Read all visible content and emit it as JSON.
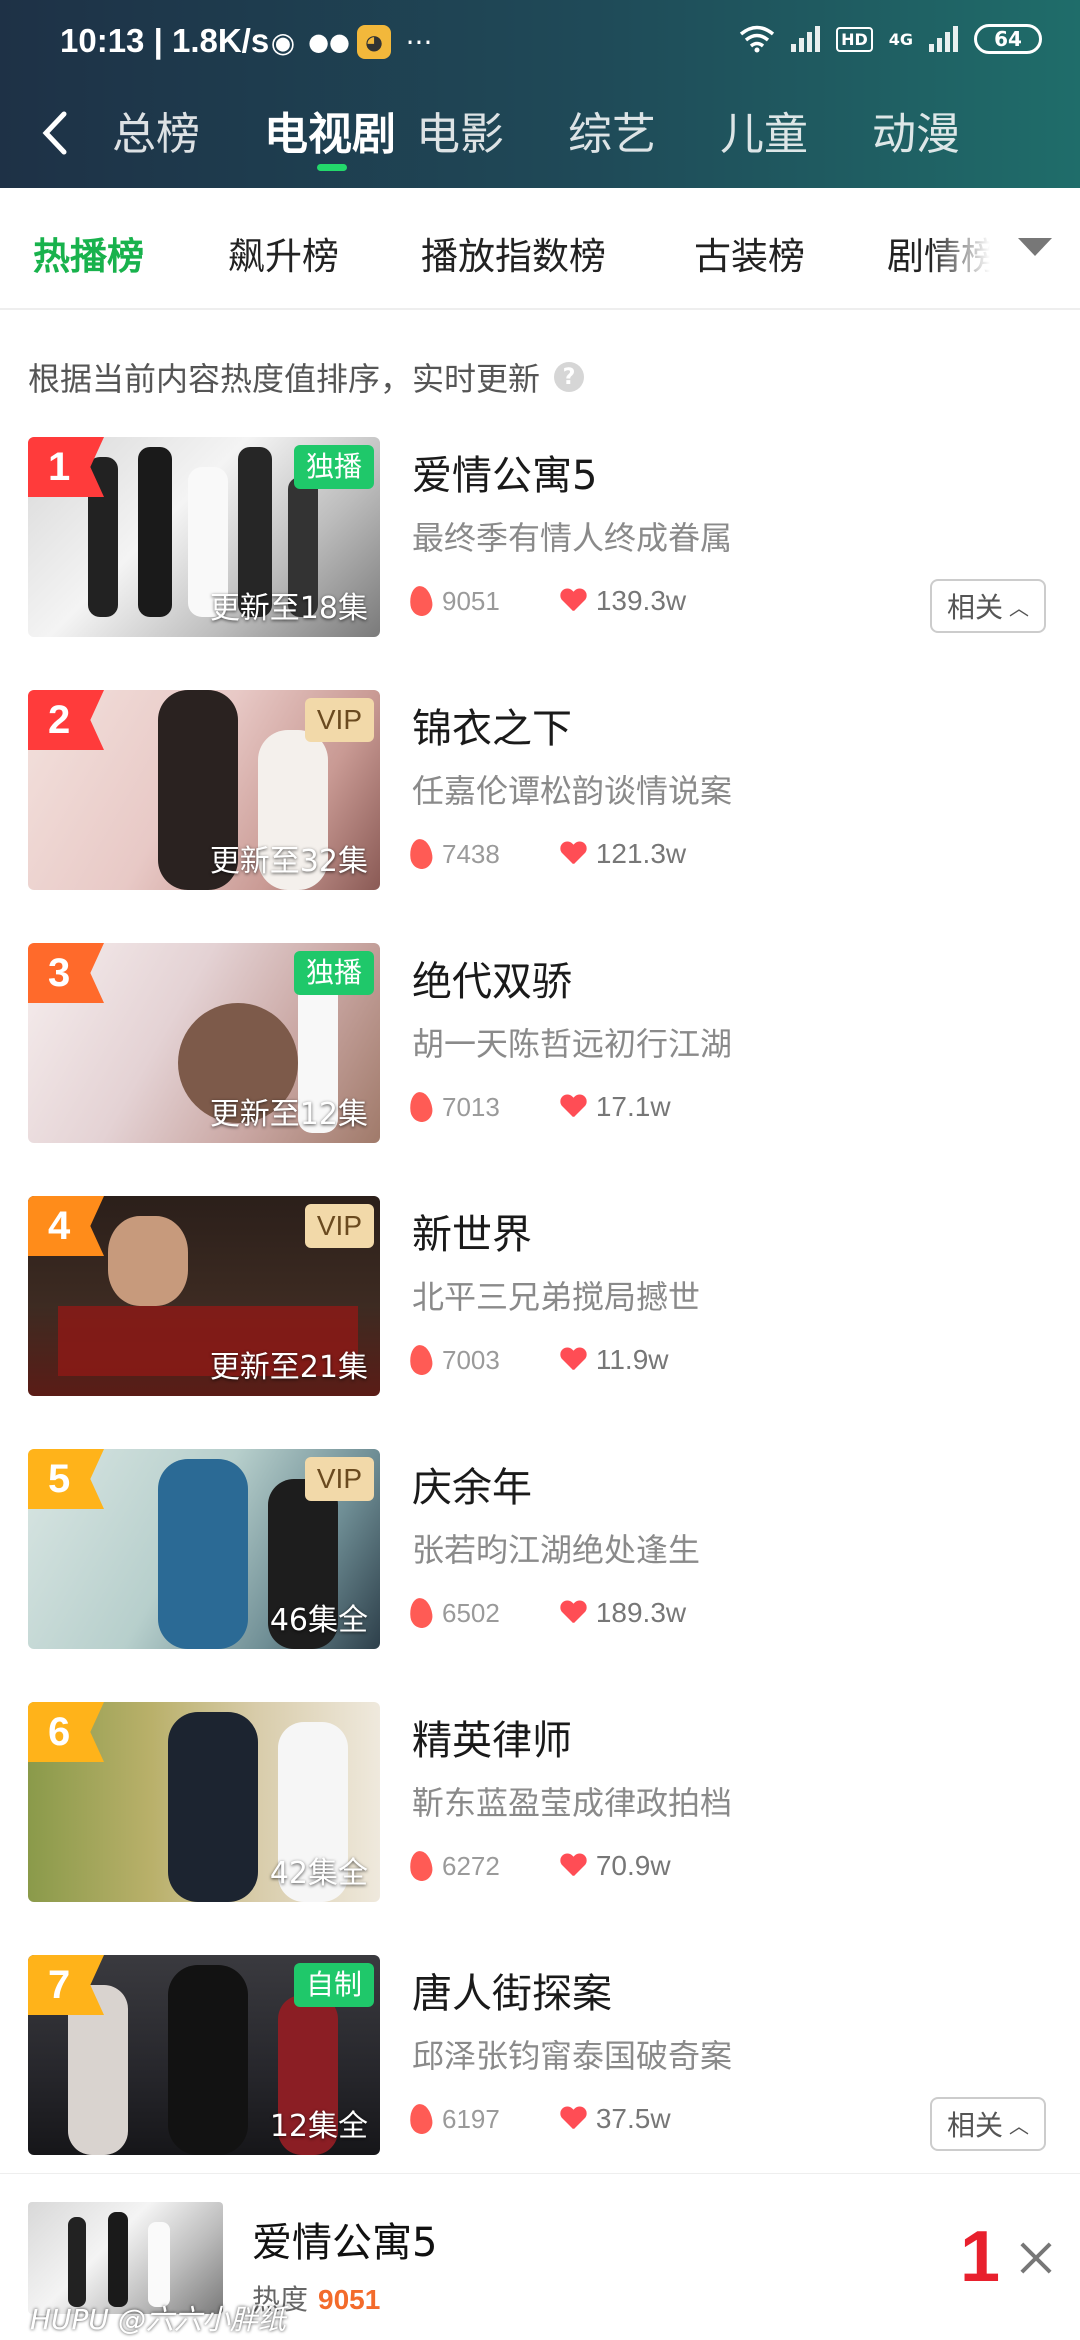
{
  "status_bar": {
    "time": "10:13 | 1.8K/s",
    "battery": "64",
    "hd": "HD",
    "net": "4G"
  },
  "nav": {
    "tabs": [
      "总榜",
      "电视剧",
      "电影",
      "综艺",
      "儿童",
      "动漫"
    ],
    "active_index": 1
  },
  "subtabs": {
    "items": [
      "热播榜",
      "飙升榜",
      "播放指数榜",
      "古装榜",
      "剧情榜"
    ],
    "active_index": 0
  },
  "description": "根据当前内容热度值排序，实时更新",
  "related_label": "相关",
  "items": [
    {
      "rank": "1",
      "title": "爱情公寓5",
      "subtitle": "最终季有情人终成眷属",
      "badge": "独播",
      "episodes": "更新至18集",
      "heat": "9051",
      "likes": "139.3w"
    },
    {
      "rank": "2",
      "title": "锦衣之下",
      "subtitle": "任嘉伦谭松韵谈情说案",
      "badge": "VIP",
      "episodes": "更新至32集",
      "heat": "7438",
      "likes": "121.3w"
    },
    {
      "rank": "3",
      "title": "绝代双骄",
      "subtitle": "胡一天陈哲远初行江湖",
      "badge": "独播",
      "episodes": "更新至12集",
      "heat": "7013",
      "likes": "17.1w"
    },
    {
      "rank": "4",
      "title": "新世界",
      "subtitle": "北平三兄弟搅局撼世",
      "badge": "VIP",
      "episodes": "更新至21集",
      "heat": "7003",
      "likes": "11.9w"
    },
    {
      "rank": "5",
      "title": "庆余年",
      "subtitle": "张若昀江湖绝处逢生",
      "badge": "VIP",
      "episodes": "46集全",
      "heat": "6502",
      "likes": "189.3w"
    },
    {
      "rank": "6",
      "title": "精英律师",
      "subtitle": "靳东蓝盈莹成律政拍档",
      "badge": "",
      "episodes": "42集全",
      "heat": "6272",
      "likes": "70.9w"
    },
    {
      "rank": "7",
      "title": "唐人街探案",
      "subtitle": "邱泽张钧甯泰国破奇案",
      "badge": "自制",
      "episodes": "12集全",
      "heat": "6197",
      "likes": "37.5w"
    }
  ],
  "mini_player": {
    "title": "爱情公寓5",
    "heat_label": "热度",
    "heat_value": "9051",
    "rank": "1"
  },
  "watermark": "HUPU @六六小胖纸",
  "colors": {
    "accent": "#18b24c",
    "rank_colors": [
      "#ff3b3b",
      "#ff3b3b",
      "#ff6a2b",
      "#ff8c1a",
      "#ffb31a",
      "#ffb31a",
      "#ffb31a"
    ]
  }
}
